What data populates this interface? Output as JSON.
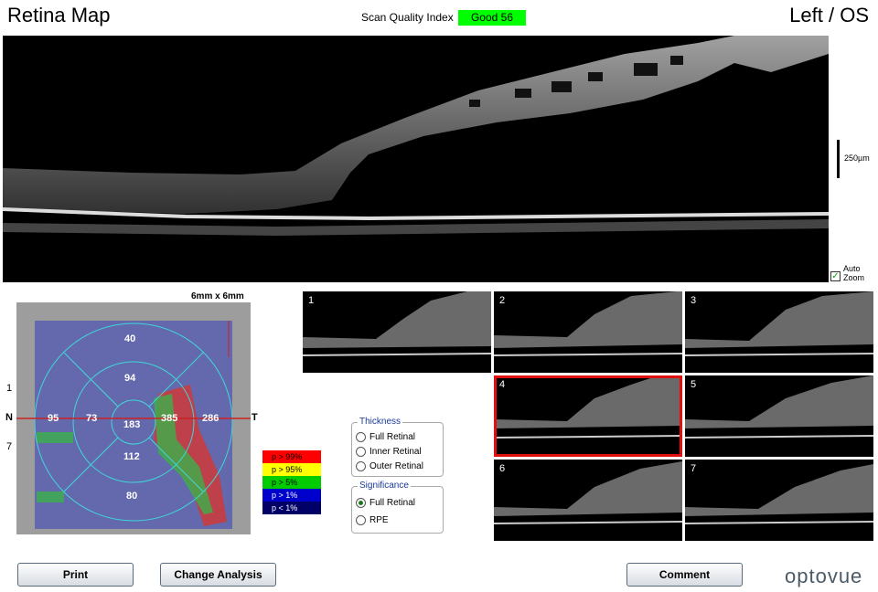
{
  "header": {
    "title": "Retina Map",
    "eye": "Left / OS",
    "scan_quality_label": "Scan Quality Index",
    "scan_quality_value": "Good  56",
    "scan_quality_color": "#00ff00"
  },
  "bscan": {
    "scale_label": "250µm",
    "auto_zoom_label_1": "Auto",
    "auto_zoom_label_2": "Zoom",
    "auto_zoom_checked": true
  },
  "thickness_map": {
    "size_label": "6mm x 6mm",
    "axis_nasal": "N",
    "axis_temporal": "T",
    "tick_top": "1",
    "tick_bottom": "7",
    "values": {
      "superior_outer": "40",
      "superior_inner": "94",
      "nasal_outer": "95",
      "nasal_inner": "73",
      "central": "183",
      "temporal_inner": "385",
      "temporal_outer": "286",
      "inferior_inner": "112",
      "inferior_outer": "80"
    }
  },
  "legend": [
    {
      "label": "p > 99%",
      "color": "#ff0000",
      "text_color": "#000000"
    },
    {
      "label": "p > 95%",
      "color": "#ffff00",
      "text_color": "#000000"
    },
    {
      "label": "p > 5%",
      "color": "#00cc00",
      "text_color": "#000000"
    },
    {
      "label": "p > 1%",
      "color": "#0000cc",
      "text_color": "#ffffff"
    },
    {
      "label": "p < 1%",
      "color": "#000066",
      "text_color": "#ffffff"
    }
  ],
  "thumbnails": [
    {
      "num": "1",
      "selected": false
    },
    {
      "num": "2",
      "selected": false
    },
    {
      "num": "3",
      "selected": false
    },
    {
      "num": "4",
      "selected": true
    },
    {
      "num": "5",
      "selected": false
    },
    {
      "num": "6",
      "selected": false
    },
    {
      "num": "7",
      "selected": false
    }
  ],
  "thickness_group": {
    "title": "Thickness",
    "options": [
      "Full Retinal",
      "Inner Retinal",
      "Outer Retinal"
    ],
    "selected": null
  },
  "significance_group": {
    "title": "Significance",
    "options": [
      "Full Retinal",
      "RPE"
    ],
    "selected": "Full Retinal"
  },
  "buttons": {
    "print": "Print",
    "change_analysis": "Change Analysis",
    "comment": "Comment"
  },
  "brand": {
    "logo_text": "optovue"
  }
}
